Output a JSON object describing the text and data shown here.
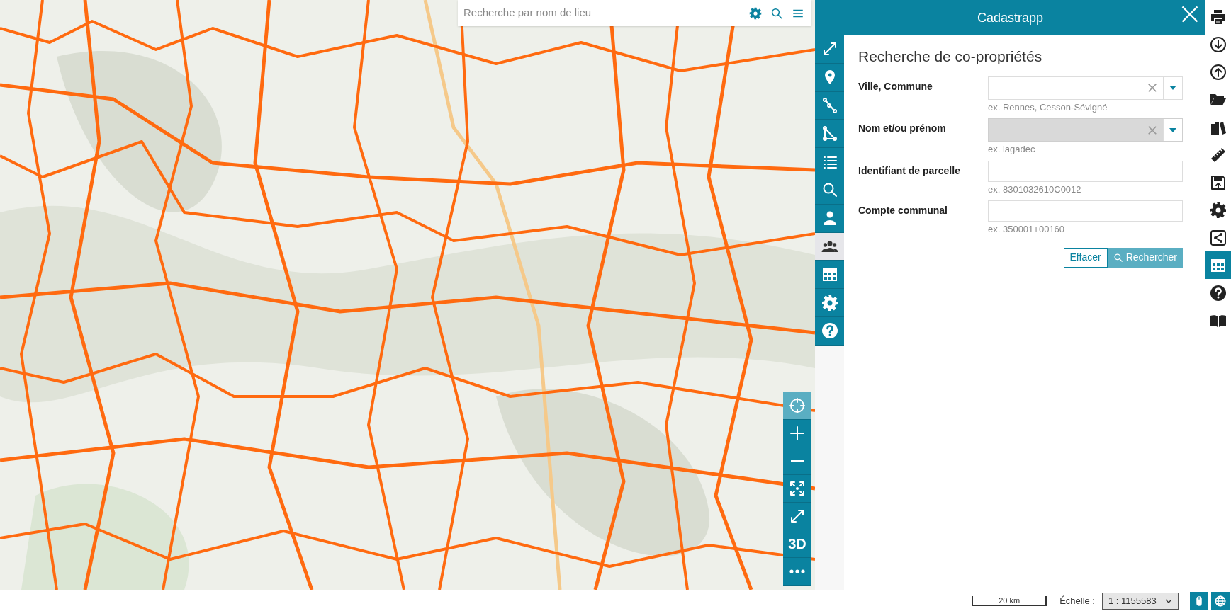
{
  "search": {
    "placeholder": "Recherche par nom de lieu"
  },
  "map_controls": [
    {
      "kind": "locate",
      "selected": true
    },
    {
      "kind": "zoom_in",
      "selected": false
    },
    {
      "kind": "zoom_out",
      "selected": false
    },
    {
      "kind": "extent",
      "selected": false
    },
    {
      "kind": "fullscreen",
      "selected": false
    },
    {
      "kind": "text",
      "label": "3D",
      "selected": false
    },
    {
      "kind": "more",
      "selected": false
    }
  ],
  "panel": {
    "title": "Cadastrapp",
    "tools": [
      {
        "kind": "expand",
        "selected": false
      },
      {
        "kind": "pin",
        "selected": false
      },
      {
        "kind": "line",
        "selected": false
      },
      {
        "kind": "polygon",
        "selected": false
      },
      {
        "kind": "list",
        "selected": false
      },
      {
        "kind": "search",
        "selected": false
      },
      {
        "kind": "user",
        "selected": false
      },
      {
        "kind": "users",
        "selected": true
      },
      {
        "kind": "table",
        "selected": false
      },
      {
        "kind": "gear",
        "selected": false
      },
      {
        "kind": "help",
        "selected": false
      }
    ],
    "heading": "Recherche de co-propriétés",
    "fields": [
      {
        "label": "Ville, Commune",
        "kind": "combo",
        "disabled": false,
        "hint": "ex. Rennes, Cesson-Sévigné"
      },
      {
        "label": "Nom et/ou prénom",
        "kind": "combo",
        "disabled": true,
        "hint": "ex. lagadec"
      },
      {
        "label": "Identifiant de parcelle",
        "kind": "text",
        "disabled": false,
        "hint": "ex. 8301032610C0012"
      },
      {
        "label": "Compte communal",
        "kind": "text",
        "disabled": false,
        "hint": "ex. 350001+00160"
      }
    ],
    "buttons": [
      {
        "label": "Effacer",
        "kind": "outline"
      },
      {
        "label": "Rechercher",
        "kind": "primary"
      }
    ]
  },
  "right_toolbar": [
    {
      "kind": "print",
      "selected": false
    },
    {
      "kind": "download",
      "selected": false
    },
    {
      "kind": "upload",
      "selected": false
    },
    {
      "kind": "folder",
      "selected": false
    },
    {
      "kind": "catalog",
      "selected": false
    },
    {
      "kind": "ruler",
      "selected": false
    },
    {
      "kind": "save",
      "selected": false
    },
    {
      "kind": "gear",
      "selected": false
    },
    {
      "kind": "share",
      "selected": false
    },
    {
      "kind": "table",
      "selected": true
    },
    {
      "kind": "help",
      "selected": false
    },
    {
      "kind": "book",
      "selected": false
    }
  ],
  "status_bar": {
    "scale_bar": "20 km",
    "scale_label": "Échelle :",
    "scale_value": "1 : 1155583",
    "buttons": [
      {
        "kind": "mouse"
      },
      {
        "kind": "globe"
      }
    ]
  }
}
